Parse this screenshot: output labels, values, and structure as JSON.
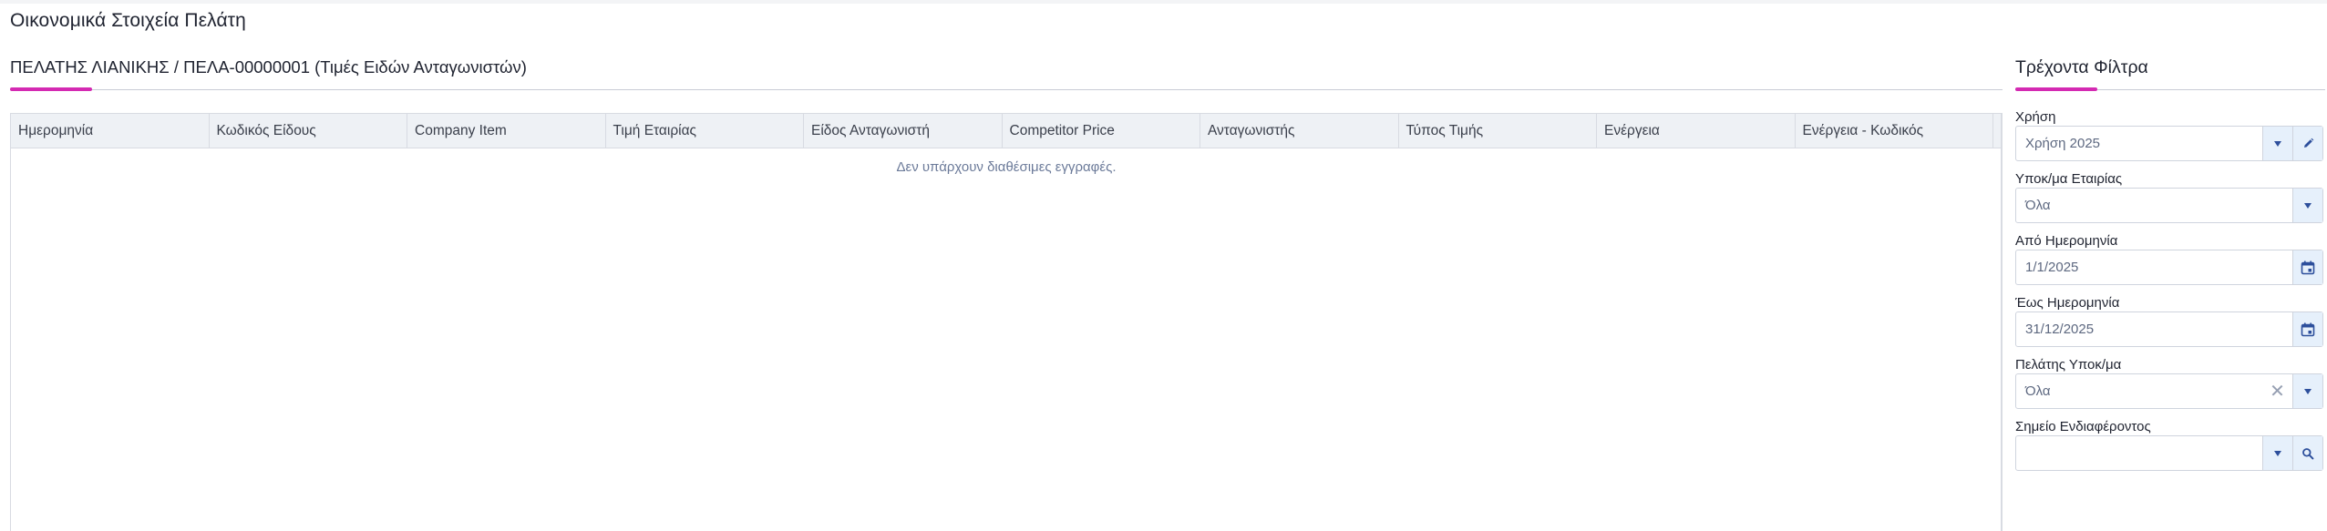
{
  "page": {
    "title": "Οικονομικά Στοιχεία Πελάτη"
  },
  "main": {
    "section_header": "ΠΕΛΑΤΗΣ ΛΙΑΝΙΚΗΣ / ΠΕΛΑ-00000001 (Τιμές Ειδών Ανταγωνιστών)",
    "grid": {
      "columns": [
        "Ημερομηνία",
        "Κωδικός Είδους",
        "Company Item",
        "Τιμή Εταιρίας",
        "Είδος Ανταγωνιστή",
        "Competitor Price",
        "Ανταγωνιστής",
        "Τύπος Τιμής",
        "Ενέργεια",
        "Ενέργεια - Κωδικός"
      ],
      "empty_message": "Δεν υπάρχουν διαθέσιμες εγγραφές."
    }
  },
  "filters": {
    "title": "Τρέχοντα Φίλτρα",
    "fields": [
      {
        "label": "Χρήση",
        "value": "Χρήση 2025",
        "buttons": [
          "chevron-down-icon",
          "pencil-icon"
        ]
      },
      {
        "label": "Υποκ/μα Εταιρίας",
        "value": "Όλα",
        "buttons": [
          "chevron-down-icon"
        ]
      },
      {
        "label": "Από Ημερομηνία",
        "value": "1/1/2025",
        "buttons": [
          "calendar-icon"
        ]
      },
      {
        "label": "Έως Ημερομηνία",
        "value": "31/12/2025",
        "buttons": [
          "calendar-icon"
        ]
      },
      {
        "label": "Πελάτης Υποκ/μα",
        "value": "Όλα",
        "buttons": [
          "clear-icon",
          "chevron-down-icon"
        ]
      },
      {
        "label": "Σημείο Ενδιαφέροντος",
        "value": "",
        "buttons": [
          "chevron-down-icon",
          "search-icon"
        ]
      }
    ]
  },
  "colors": {
    "accent": "#d42ab2",
    "button_bg": "#e6f0fb",
    "icon": "#2d4f9c",
    "grid_header_bg": "#eef1f5"
  }
}
